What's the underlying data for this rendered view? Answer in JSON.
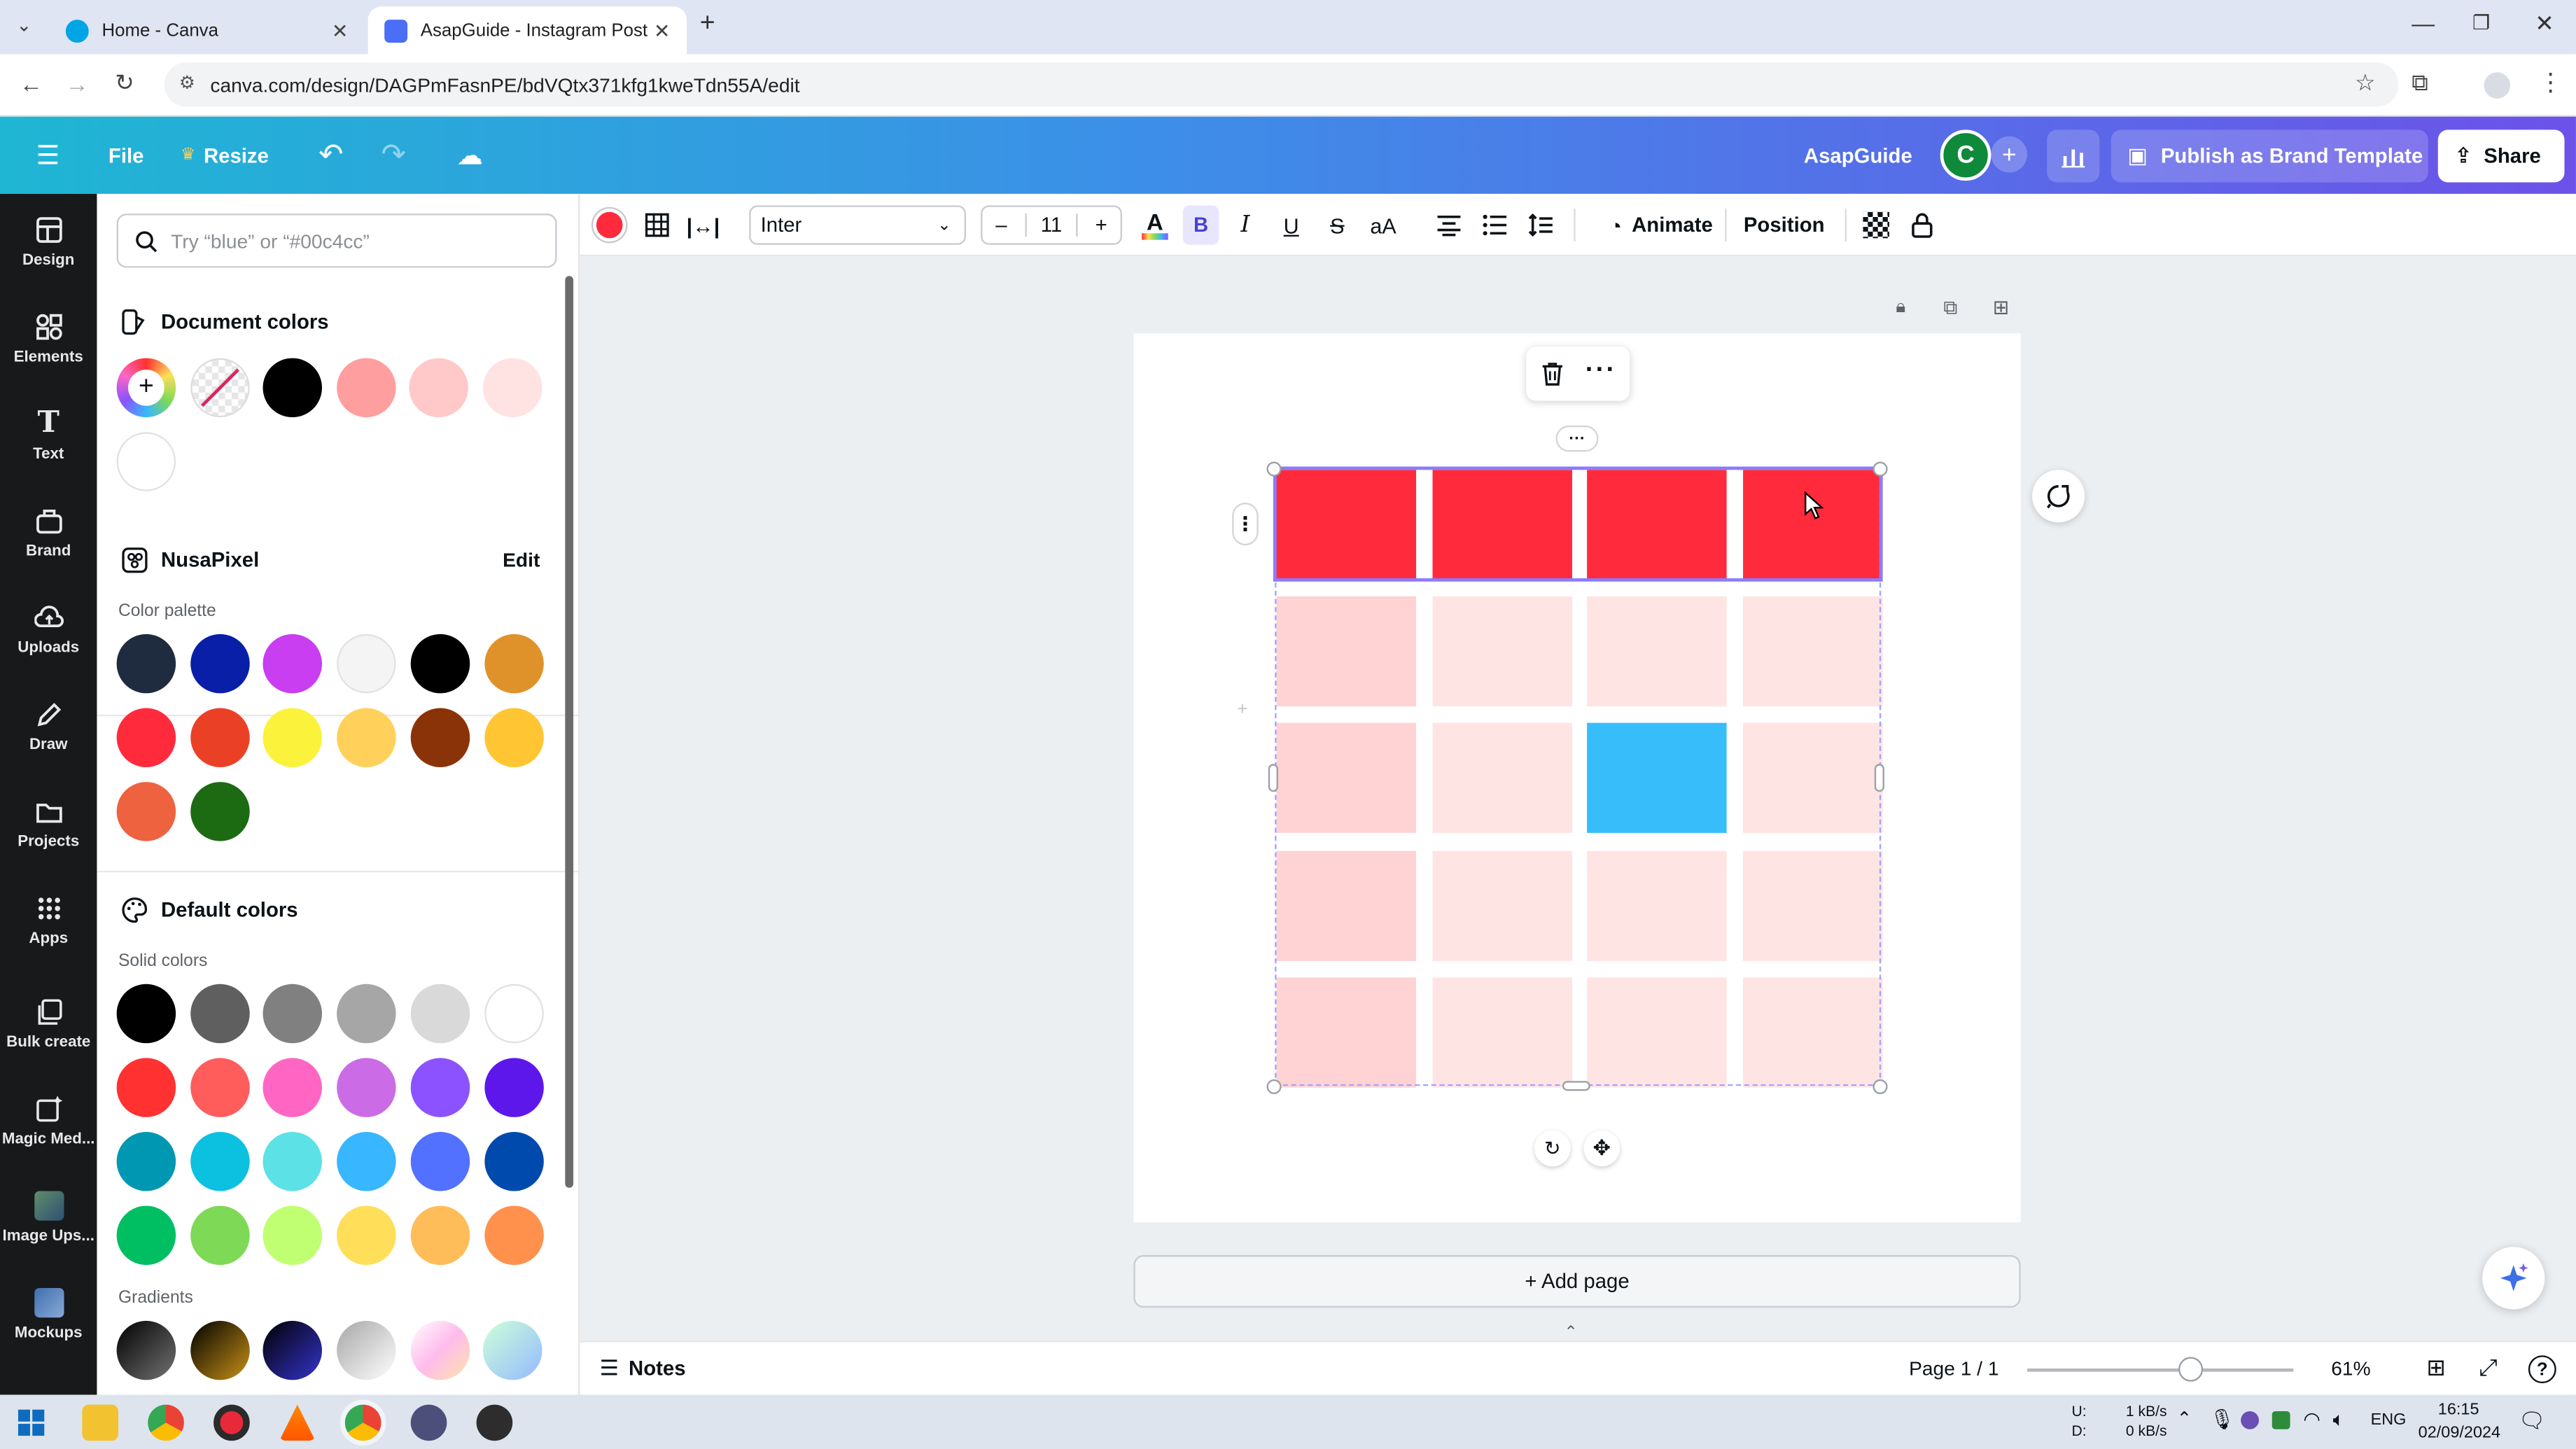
{
  "browser": {
    "tabs": [
      {
        "title": "Home - Canva",
        "active": false
      },
      {
        "title": "AsapGuide - Instagram Post",
        "active": true
      }
    ],
    "url": "canva.com/design/DAGPmFasnPE/bdVQtx371kfg1kweTdn55A/edit"
  },
  "header": {
    "file": "File",
    "resize": "Resize",
    "project_name": "AsapGuide",
    "avatar_letter": "C",
    "publish": "Publish as Brand Template",
    "share": "Share"
  },
  "rail": [
    {
      "label": "Design",
      "icon": "layout-icon"
    },
    {
      "label": "Elements",
      "icon": "shapes-icon"
    },
    {
      "label": "Text",
      "icon": "text-icon"
    },
    {
      "label": "Brand",
      "icon": "brand-icon"
    },
    {
      "label": "Uploads",
      "icon": "cloud-upload-icon"
    },
    {
      "label": "Draw",
      "icon": "pen-icon"
    },
    {
      "label": "Projects",
      "icon": "folder-icon"
    },
    {
      "label": "Apps",
      "icon": "grid-icon"
    },
    {
      "label": "Bulk create",
      "icon": "bulk-icon"
    },
    {
      "label": "Magic Med...",
      "icon": "magic-icon"
    },
    {
      "label": "Image Ups...",
      "icon": "image-upscale-icon"
    },
    {
      "label": "Mockups",
      "icon": "mockup-icon"
    }
  ],
  "panel": {
    "search_placeholder": "Try “blue” or “#00c4cc”",
    "document_colors": {
      "title": "Document colors",
      "colors": [
        "#000000",
        "#ff9e9e",
        "#ffc9c9",
        "#ffe2e2",
        "#ffffff"
      ]
    },
    "brand_kit": {
      "title": "NusaPixel",
      "edit": "Edit",
      "subtitle": "Color palette",
      "colors": [
        "#1f2b3e",
        "#0a1fa8",
        "#c83ef0",
        "#f4f4f4",
        "#000000",
        "#e0922a",
        "#ff2b3d",
        "#ea4126",
        "#fbf23b",
        "#ffd15a",
        "#8b3308",
        "#ffc532",
        "#ee6240",
        "#1c6b12"
      ]
    },
    "default_colors": {
      "title": "Default colors",
      "solid_title": "Solid colors",
      "solid": [
        "#000000",
        "#5f5f5f",
        "#808080",
        "#a6a6a6",
        "#d9d9d9",
        "#ffffff",
        "#ff3131",
        "#ff5c5c",
        "#ff66c4",
        "#cb6ce6",
        "#8c52ff",
        "#5e17eb",
        "#0097b2",
        "#0cc0df",
        "#5ce1e6",
        "#38b6ff",
        "#5271ff",
        "#004aad",
        "#00bf63",
        "#7ed957",
        "#c1ff72",
        "#ffde59",
        "#ffbd59",
        "#ff914d"
      ],
      "gradients_title": "Gradients"
    }
  },
  "toolbar": {
    "font": "Inter",
    "font_size": "11",
    "minus": "–",
    "plus": "+",
    "animate": "Animate",
    "position": "Position",
    "current_color": "#ff2b3d"
  },
  "canvas": {
    "table": {
      "rows": 5,
      "cols": 4,
      "colors": [
        [
          "#ff2b3d",
          "#ff2b3d",
          "#ff2b3d",
          "#ff2b3d"
        ],
        [
          "#ffd2d3",
          "#ffe4e4",
          "#ffe4e4",
          "#ffe4e4"
        ],
        [
          "#ffd2d3",
          "#ffe4e4",
          "#38bdfb",
          "#ffe4e4"
        ],
        [
          "#ffd2d3",
          "#ffe4e4",
          "#ffe4e4",
          "#ffe4e4"
        ],
        [
          "#ffd2d3",
          "#ffe4e4",
          "#ffe4e4",
          "#ffe4e4"
        ]
      ]
    },
    "add_page": "+ Add page"
  },
  "bottom": {
    "notes": "Notes",
    "page": "Page 1 / 1",
    "zoom": "61%",
    "zoom_fraction": 0.61
  },
  "taskbar": {
    "net_up_label": "U:",
    "net_down_label": "D:",
    "net_up": "1 kB/s",
    "net_down": "0 kB/s",
    "lang": "ENG",
    "time": "16:15",
    "date": "02/09/2024"
  }
}
